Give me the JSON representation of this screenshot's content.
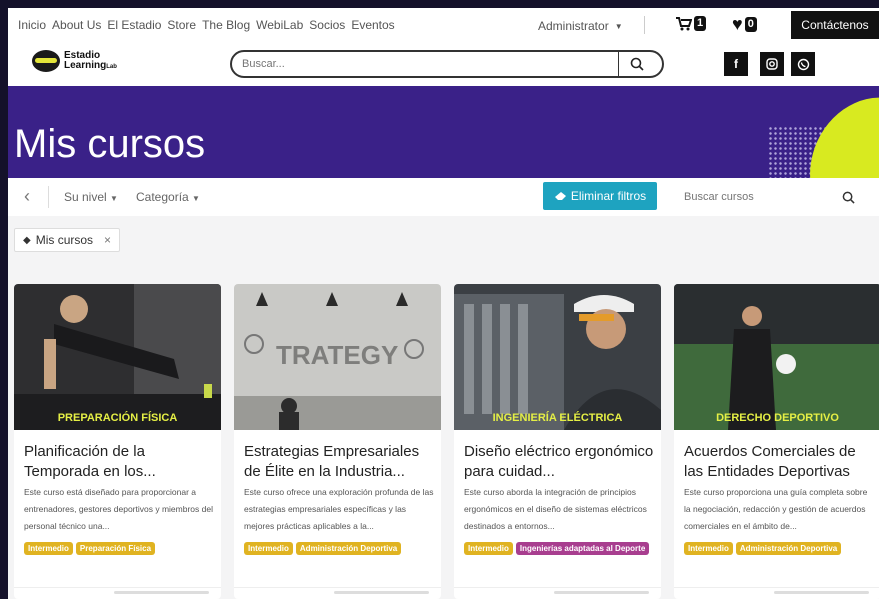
{
  "topnav": {
    "items": [
      "Inicio",
      "About Us",
      "El Estadio",
      "Store",
      "The Blog",
      "WebiLab",
      "Socios",
      "Eventos"
    ],
    "user": "Administrator",
    "cart_count": "1",
    "wishlist_count": "0",
    "contact_label": "Contáctenos"
  },
  "header": {
    "logo_line1": "Estadio",
    "logo_line2": "Learning",
    "logo_suffix": "Lab",
    "search_placeholder": "Buscar...",
    "social": [
      "facebook-icon",
      "instagram-icon",
      "whatsapp-icon"
    ]
  },
  "hero": {
    "title": "Mis cursos",
    "accent_color": "#d8ea20",
    "bg_color": "#3a2188"
  },
  "filters": {
    "level_label": "Su nivel",
    "category_label": "Categoría",
    "clear_label": "Eliminar filtros",
    "search_placeholder": "Buscar cursos",
    "active_chip": "Mis cursos"
  },
  "courses": [
    {
      "category": "PREPARACIÓN FÍSICA",
      "title": "Planificación de la Temporada en los...",
      "description": "Este curso está diseñado para proporcionar a entrenadores, gestores deportivos y miembros del personal técnico una...",
      "tags": [
        "Intermedio",
        "Preparación Física"
      ]
    },
    {
      "category": "",
      "title": "Estrategias Empresariales de Élite en la Industria...",
      "description": "Este curso ofrece una exploración profunda de las estrategias empresariales específicas y las mejores prácticas aplicables a la...",
      "tags": [
        "Intermedio",
        "Administración Deportiva"
      ]
    },
    {
      "category": "INGENIERÍA ELÉCTRICA",
      "title": "Diseño eléctrico ergonómico para cuidad...",
      "description": "Este curso aborda la integración de principios ergonómicos en el diseño de sistemas eléctricos destinados a entornos...",
      "tags": [
        "Intermedio",
        "Ingenierías adaptadas al Deporte"
      ]
    },
    {
      "category": "DERECHO DEPORTIVO",
      "title": "Acuerdos Comerciales de las Entidades Deportivas",
      "description": "Este curso proporciona una guía completa sobre la negociación, redacción y gestión de acuerdos comerciales en el ámbito de...",
      "tags": [
        "Intermedio",
        "Administración Deportiva"
      ]
    }
  ]
}
